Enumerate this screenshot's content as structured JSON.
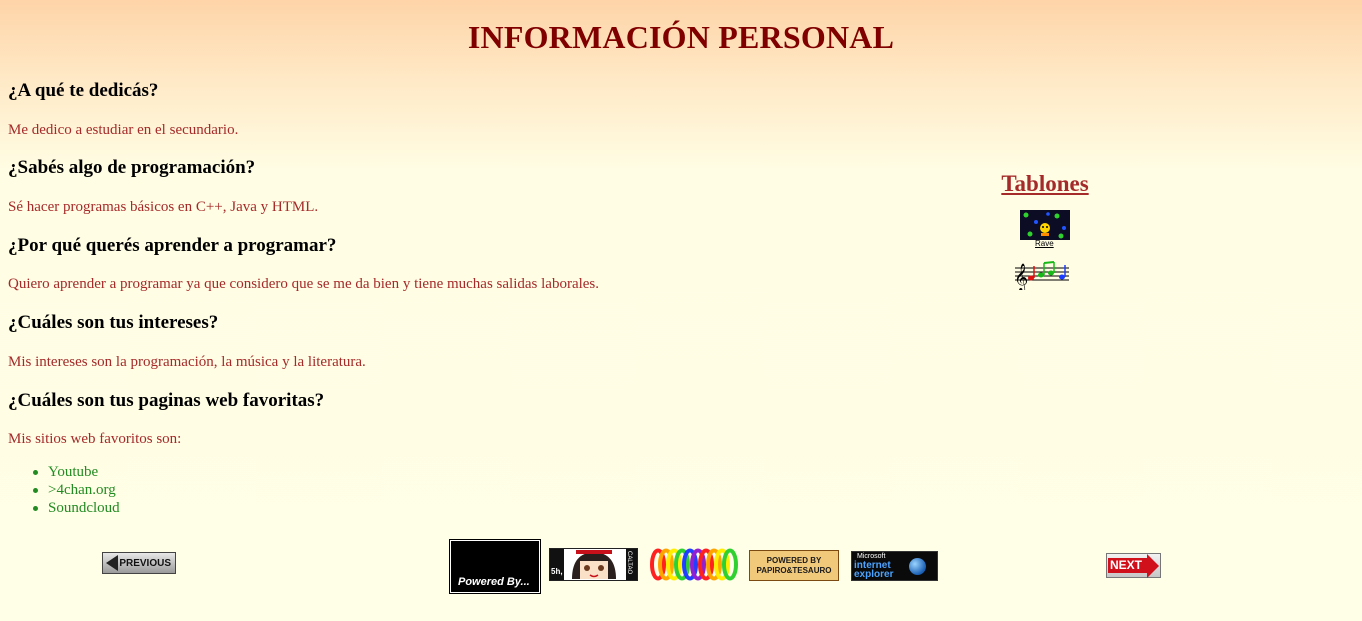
{
  "page": {
    "title": "INFORMACIÓN PERSONAL"
  },
  "qa": [
    {
      "question": "¿A qué te dedicás?",
      "answer": "Me dedico a estudiar en el secundario."
    },
    {
      "question": "¿Sabés algo de programación?",
      "answer": "Sé hacer programas básicos en C++, Java y HTML."
    },
    {
      "question": "¿Por qué querés aprender a programar?",
      "answer": "Quiero aprender a programar ya que considero que se me da bien y tiene muchas salidas laborales."
    },
    {
      "question": "¿Cuáles son tus intereses?",
      "answer": "Mis intereses son la programación, la música y la literatura."
    },
    {
      "question": "¿Cuáles son tus paginas web favoritas?",
      "answer": "Mis sitios web favoritos son:"
    }
  ],
  "favorites": [
    "Youtube",
    ">4chan.org",
    "Soundcloud"
  ],
  "sidebar": {
    "title": "Tablones",
    "rave_label": "Rave"
  },
  "footer": {
    "previous_label": "PREVIOUS",
    "next_label": "NEXT",
    "powered_label": "Powered By...",
    "anime_left_label": "5h,",
    "anime_right_label": "CALTAO",
    "papiro_label": "POWERED BY PAPIRO&TESAURO",
    "ie_microsoft": "Microsoft",
    "ie_name": "internet explorer"
  },
  "colors": {
    "title": "#800000",
    "answer": "#a52a2a",
    "link": "#228b22",
    "sidebar_title": "#a52a2a"
  }
}
